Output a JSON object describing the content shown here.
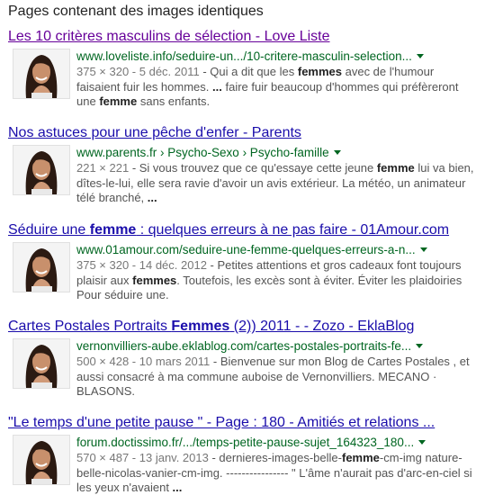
{
  "heading": "Pages contenant des images identiques",
  "results": [
    {
      "title": [
        "Les 10 critères masculins de sélection - Love Liste"
      ],
      "url": "www.loveliste.info/seduire-un.../10-critere-masculin-selection...",
      "meta": "375 × 320 - 5 déc. 2011",
      "snippet": [
        " - Qui a dit que les ",
        "femmes",
        " avec de l'humour faisaient fuir les hommes. ",
        "...",
        " faire fuir beaucoup d'hommes qui préfèreront une ",
        "femme",
        " sans enfants."
      ]
    },
    {
      "title": [
        "Nos astuces pour une pêche d'enfer - Parents"
      ],
      "url": "www.parents.fr › Psycho-Sexo › Psycho-famille",
      "meta": "221 × 221",
      "snippet": [
        " - Si vous trouvez que ce qu'essaye cette jeune ",
        "femme",
        " lui va bien, dîtes-le-lui, elle sera ravie d'avoir un avis extérieur. La météo, un animateur télé branché, ",
        "...",
        ""
      ]
    },
    {
      "title": [
        "Séduire une ",
        "femme",
        " : quelques erreurs à ne pas faire - 01Amour.com"
      ],
      "url": "www.01amour.com/seduire-une-femme-quelques-erreurs-a-n...",
      "meta": "375 × 320 - 14 déc. 2012",
      "snippet": [
        " - Petites attentions et gros cadeaux font toujours plaisir aux ",
        "femmes",
        ". Toutefois, les excès sont à éviter. Éviter les plaidoiries Pour séduire une.",
        "",
        ""
      ]
    },
    {
      "title": [
        "Cartes Postales Portraits ",
        "Femmes",
        " (2)) 2011 - - Zozo - EklaBlog"
      ],
      "url": "vernonvilliers-aube.eklablog.com/cartes-postales-portraits-fe...",
      "meta": "500 × 428 - 10 mars 2011",
      "snippet": [
        " - Bienvenue sur mon Blog de Cartes Postales , et aussi consacré à ma commune auboise de Vernonvilliers. MECANO · BLASONS.",
        "",
        "",
        "",
        ""
      ]
    },
    {
      "title": [
        "\"Le temps d'une petite pause \" - Page : 180 - Amitiés et relations ..."
      ],
      "url": "forum.doctissimo.fr/.../temps-petite-pause-sujet_164323_180...",
      "meta": "570 × 487 - 13 janv. 2013",
      "snippet": [
        " - dernieres-images-belle-",
        "femme",
        "-cm-img nature-belle-nicolas-vanier-cm-img. ---------------- \" L'âme n'aurait pas d'arc-en-ciel si les yeux n'avaient ",
        "...",
        ""
      ]
    }
  ],
  "colors": {
    "visited_link": "#660099",
    "link": "#1a0dab",
    "url_green": "#006621",
    "snippet_gray": "#545454"
  },
  "icons": {
    "thumbnail": "woman-portrait-thumbnail",
    "url_menu": "dropdown-arrow-icon"
  }
}
